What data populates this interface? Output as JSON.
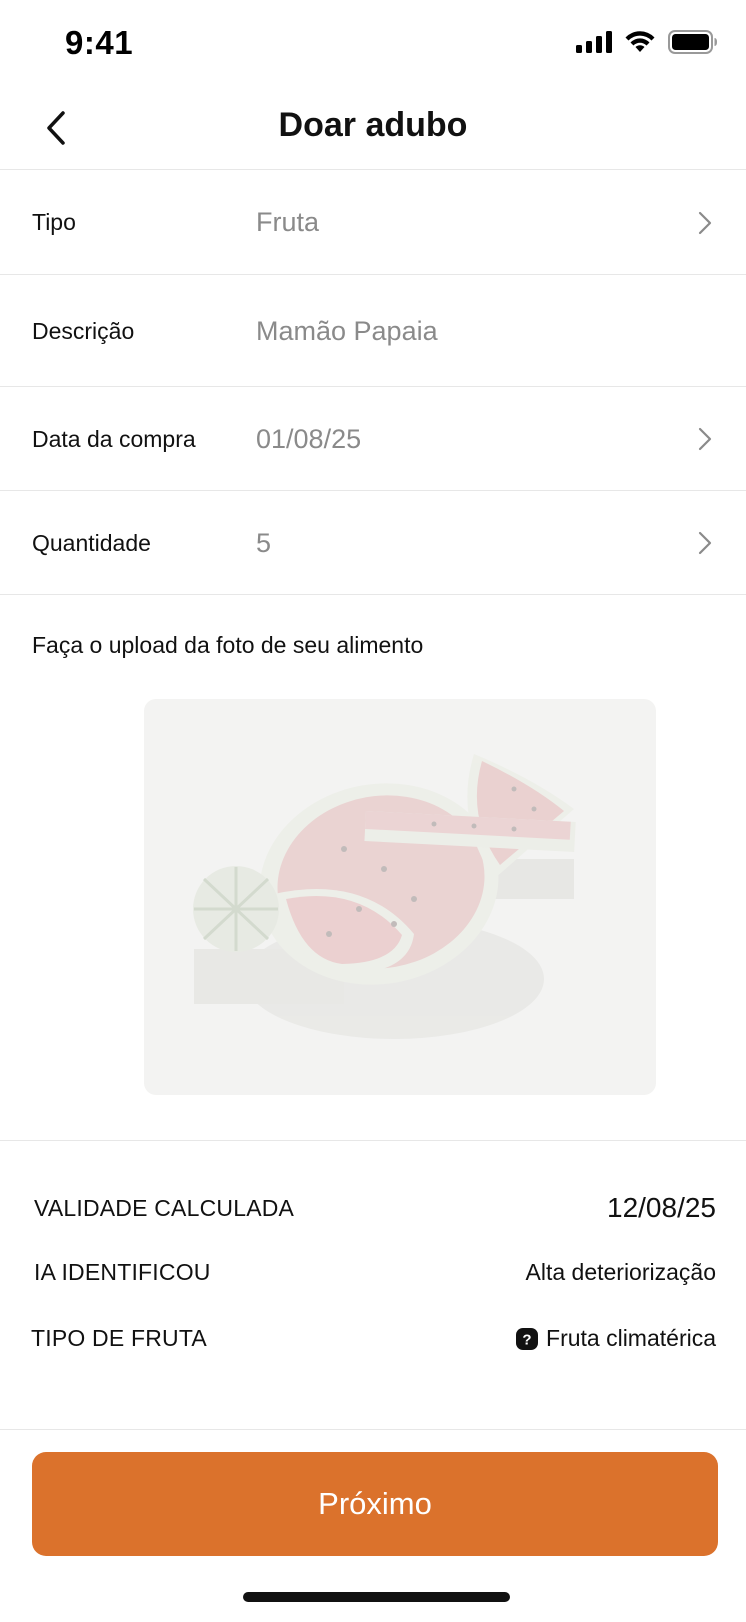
{
  "status_bar": {
    "time": "9:41"
  },
  "header": {
    "title": "Doar adubo",
    "back_icon": "chevron-left-icon"
  },
  "form": {
    "tipo": {
      "label": "Tipo",
      "value": "Fruta"
    },
    "descricao": {
      "label": "Descrição",
      "value": "Mamão Papaia"
    },
    "data_compra": {
      "label": "Data da compra",
      "value": "01/08/25"
    },
    "quantidade": {
      "label": "Quantidade",
      "value": "5"
    }
  },
  "upload": {
    "label": "Faça o upload da foto de seu alimento",
    "photo": "watermelon-slices-photo"
  },
  "summary": {
    "validade": {
      "label": "VALIDADE CALCULADA",
      "value": "12/08/25"
    },
    "ia": {
      "label": "IA IDENTIFICOU",
      "value": "Alta deteriorização"
    },
    "tipo_fruta": {
      "label": "TIPO DE FRUTA",
      "value": "Fruta climatérica",
      "icon": "help-icon"
    }
  },
  "actions": {
    "next_label": "Próximo"
  },
  "colors": {
    "accent": "#db722c",
    "muted_text": "#8a8a8a",
    "divider": "#e7e7e7"
  }
}
